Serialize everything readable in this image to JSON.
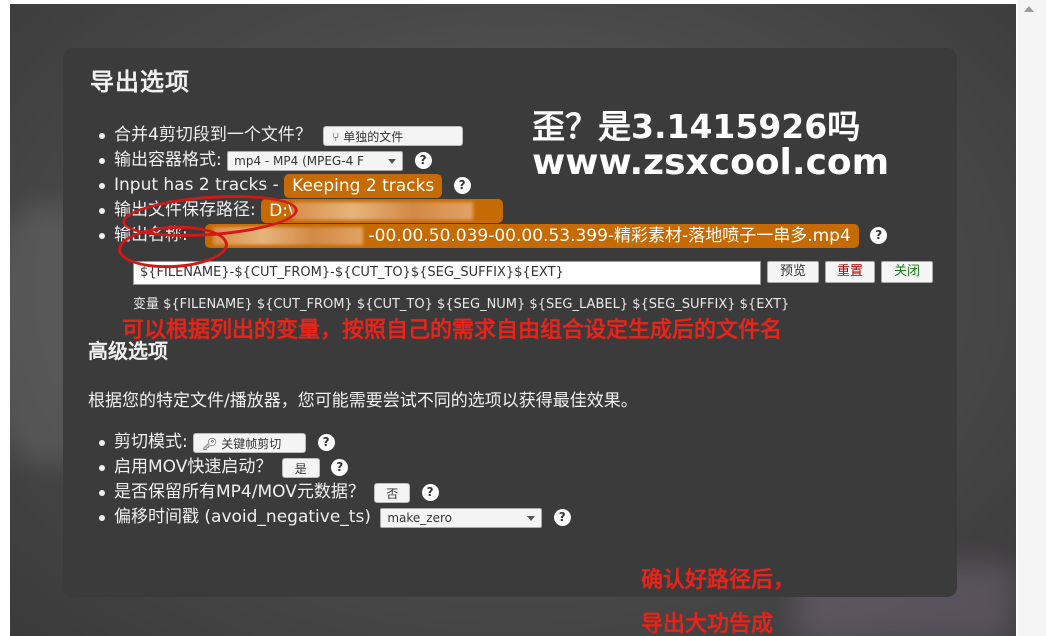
{
  "dialog": {
    "title": "导出选项",
    "options": [
      {
        "label": "合并4剪切段到一个文件？",
        "button": "单独的文件",
        "button_icon": "split-icon"
      },
      {
        "label": "输出容器格式:",
        "select": "mp4 - MP4 (MPEG-4 F"
      },
      {
        "label": "Input has 2 tracks - ",
        "value": "Keeping 2 tracks"
      },
      {
        "label": "输出文件保存路径:",
        "value": "D:\\"
      },
      {
        "label": "输出名称:",
        "value": "-00.00.50.039-00.00.53.399-精彩素材-落地喷子一串多.mp4"
      }
    ],
    "filename_template": "${FILENAME}-${CUT_FROM}-${CUT_TO}${SEG_SUFFIX}${EXT}",
    "buttons": {
      "preview": "预览",
      "reset": "重置",
      "close": "关闭"
    },
    "vars_line": "变量 ${FILENAME} ${CUT_FROM} ${CUT_TO} ${SEG_NUM} ${SEG_LABEL} ${SEG_SUFFIX} ${EXT}",
    "advanced_title": "高级选项",
    "advanced_desc": "根据您的特定文件/播放器，您可能需要尝试不同的选项以获得最佳效果。",
    "advanced": [
      {
        "label": "剪切模式:",
        "button": "关键帧剪切",
        "button_icon": "key-icon"
      },
      {
        "label": "启用MOV快速启动？",
        "button": "是"
      },
      {
        "label": "是否保留所有MP4/MOV元数据？",
        "button": "否"
      },
      {
        "label": "偏移时间戳 (avoid_negative_ts)",
        "select": "make_zero"
      }
    ],
    "help_glyph": "?"
  },
  "overlays": {
    "watermark_line1": "歪？是3.1415926吗",
    "watermark_line2": "www.zsxcool.com",
    "red_note1": "可以根据列出的变量，按照自己的需求自由组合设定生成后的文件名",
    "red_note2": "确认好路径后，",
    "red_note3": "导出大功告成"
  },
  "colors": {
    "dialog_bg": "#3b3b3b",
    "accent_orange": "#c66a04",
    "annotation_red": "#e8231a"
  }
}
